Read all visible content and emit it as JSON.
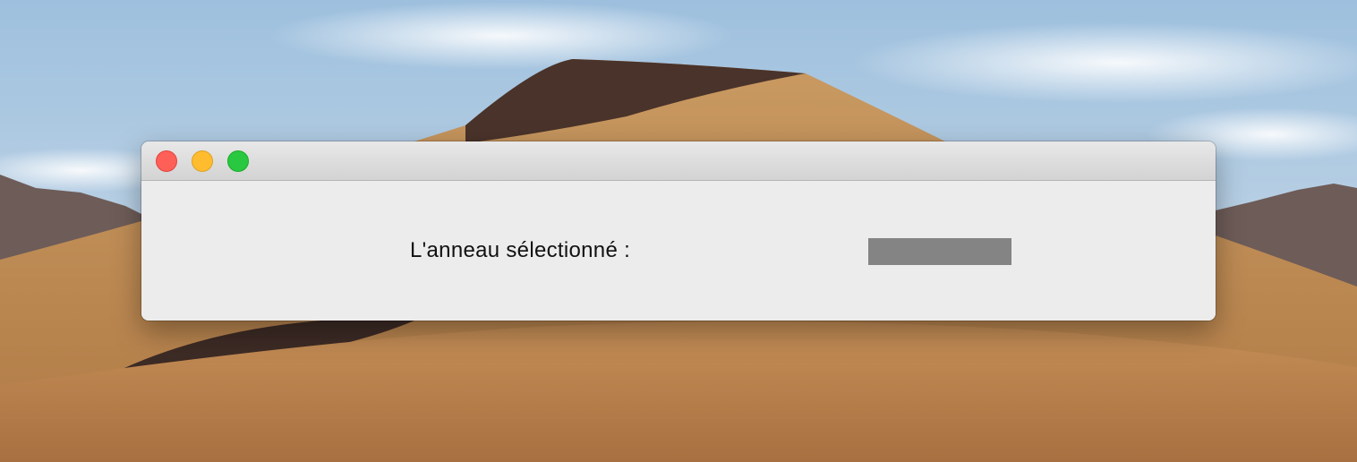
{
  "window": {
    "controls": {
      "close_color": "#fe5f57",
      "minimize_color": "#febc2e",
      "zoom_color": "#28c840"
    }
  },
  "content": {
    "ring_label": "L'anneau sélectionné :",
    "selected_ring_value": ""
  }
}
